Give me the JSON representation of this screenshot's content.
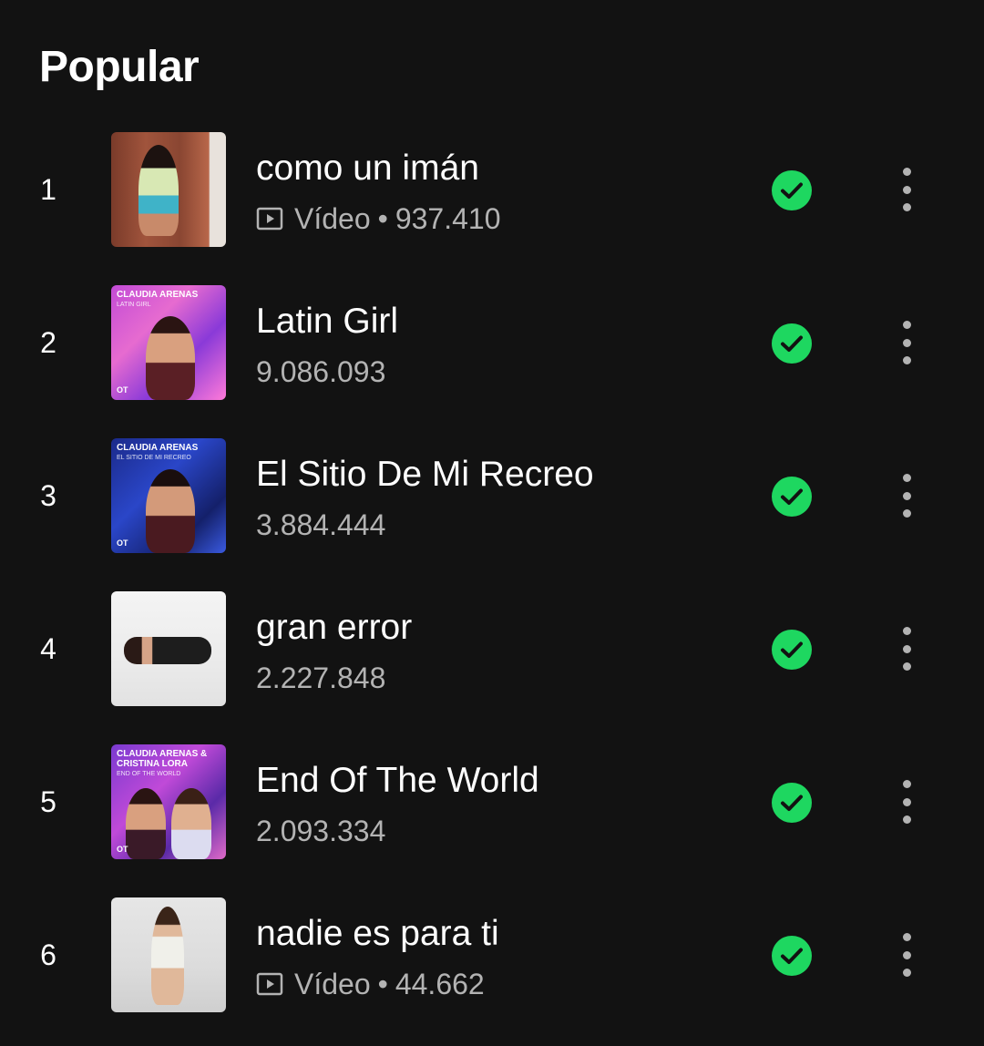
{
  "section": {
    "title": "Popular"
  },
  "colors": {
    "background": "#121212",
    "accent_green": "#1ed760",
    "secondary_text": "#b3b3b3"
  },
  "tracks": [
    {
      "index": "1",
      "title": "como un imán",
      "is_video": true,
      "video_label": "Vídeo",
      "separator": "•",
      "plays": "937.410",
      "downloaded": true,
      "cover_text": "",
      "cover_sub": "",
      "cover_badge": ""
    },
    {
      "index": "2",
      "title": "Latin Girl",
      "is_video": false,
      "plays": "9.086.093",
      "downloaded": true,
      "cover_text": "CLAUDIA ARENAS",
      "cover_sub": "LATIN GIRL",
      "cover_badge": "OT"
    },
    {
      "index": "3",
      "title": "El Sitio De Mi Recreo",
      "is_video": false,
      "plays": "3.884.444",
      "downloaded": true,
      "cover_text": "CLAUDIA ARENAS",
      "cover_sub": "EL SITIO DE MI RECREO",
      "cover_badge": "OT"
    },
    {
      "index": "4",
      "title": "gran error",
      "is_video": false,
      "plays": "2.227.848",
      "downloaded": true,
      "cover_text": "",
      "cover_sub": "",
      "cover_badge": ""
    },
    {
      "index": "5",
      "title": "End Of The World",
      "is_video": false,
      "plays": "2.093.334",
      "downloaded": true,
      "cover_text": "CLAUDIA ARENAS & CRISTINA LORA",
      "cover_sub": "END OF THE WORLD",
      "cover_badge": "OT"
    },
    {
      "index": "6",
      "title": "nadie es para ti",
      "is_video": true,
      "video_label": "Vídeo",
      "separator": "•",
      "plays": "44.662",
      "downloaded": true,
      "cover_text": "",
      "cover_sub": "",
      "cover_badge": ""
    }
  ]
}
